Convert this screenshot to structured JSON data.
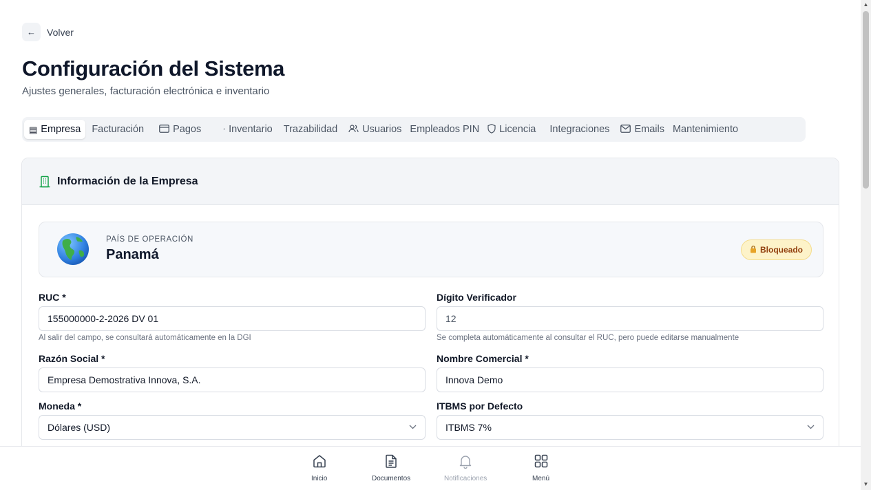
{
  "back_label": "Volver",
  "page_title": "Configuración del Sistema",
  "page_subtitle": "Ajustes generales, facturación electrónica e inventario",
  "tabs": [
    {
      "label": "Empresa",
      "icon": "building-icon",
      "active": true
    },
    {
      "label": "Facturación",
      "icon": "",
      "active": false
    },
    {
      "label": "Pagos",
      "icon": "credit-card-icon",
      "active": false
    },
    {
      "label": "Inventario",
      "icon": "dot-icon",
      "active": false
    },
    {
      "label": "Trazabilidad",
      "icon": "",
      "active": false
    },
    {
      "label": "Usuarios",
      "icon": "users-icon",
      "active": false
    },
    {
      "label": "Empleados PIN",
      "icon": "",
      "active": false
    },
    {
      "label": "Licencia",
      "icon": "shield-icon",
      "active": false
    },
    {
      "label": "Integraciones",
      "icon": "",
      "active": false
    },
    {
      "label": "Emails",
      "icon": "mail-icon",
      "active": false
    },
    {
      "label": "Mantenimiento",
      "icon": "",
      "active": false
    }
  ],
  "card": {
    "title": "Información de la Empresa",
    "country": {
      "label": "PAÍS DE OPERACIÓN",
      "name": "Panamá",
      "status": "Bloqueado"
    },
    "fields": {
      "ruc": {
        "label": "RUC *",
        "value": "155000000-2-2026 DV 01",
        "help": "Al salir del campo, se consultará automáticamente en la DGI"
      },
      "dv": {
        "label": "Dígito Verificador",
        "value": "12",
        "help": "Se completa automáticamente al consultar el RUC, pero puede editarse manualmente"
      },
      "razon_social": {
        "label": "Razón Social *",
        "value": "Empresa Demostrativa Innova, S.A."
      },
      "nombre_comercial": {
        "label": "Nombre Comercial *",
        "value": "Innova Demo"
      },
      "moneda": {
        "label": "Moneda *",
        "value": "Dólares (USD)"
      },
      "itbms": {
        "label": "ITBMS por Defecto",
        "value": "ITBMS 7%"
      }
    }
  },
  "bottom_nav": [
    {
      "label": "Inicio",
      "icon": "home-icon",
      "disabled": false
    },
    {
      "label": "Documentos",
      "icon": "document-icon",
      "disabled": false
    },
    {
      "label": "Notificaciones",
      "icon": "bell-icon",
      "disabled": true
    },
    {
      "label": "Menú",
      "icon": "grid-icon",
      "disabled": false
    }
  ],
  "colors": {
    "accent_green": "#16a34a",
    "locked_bg": "#fdf3c9",
    "locked_text": "#92400e",
    "tab_bar_bg": "#f1f3f6"
  }
}
